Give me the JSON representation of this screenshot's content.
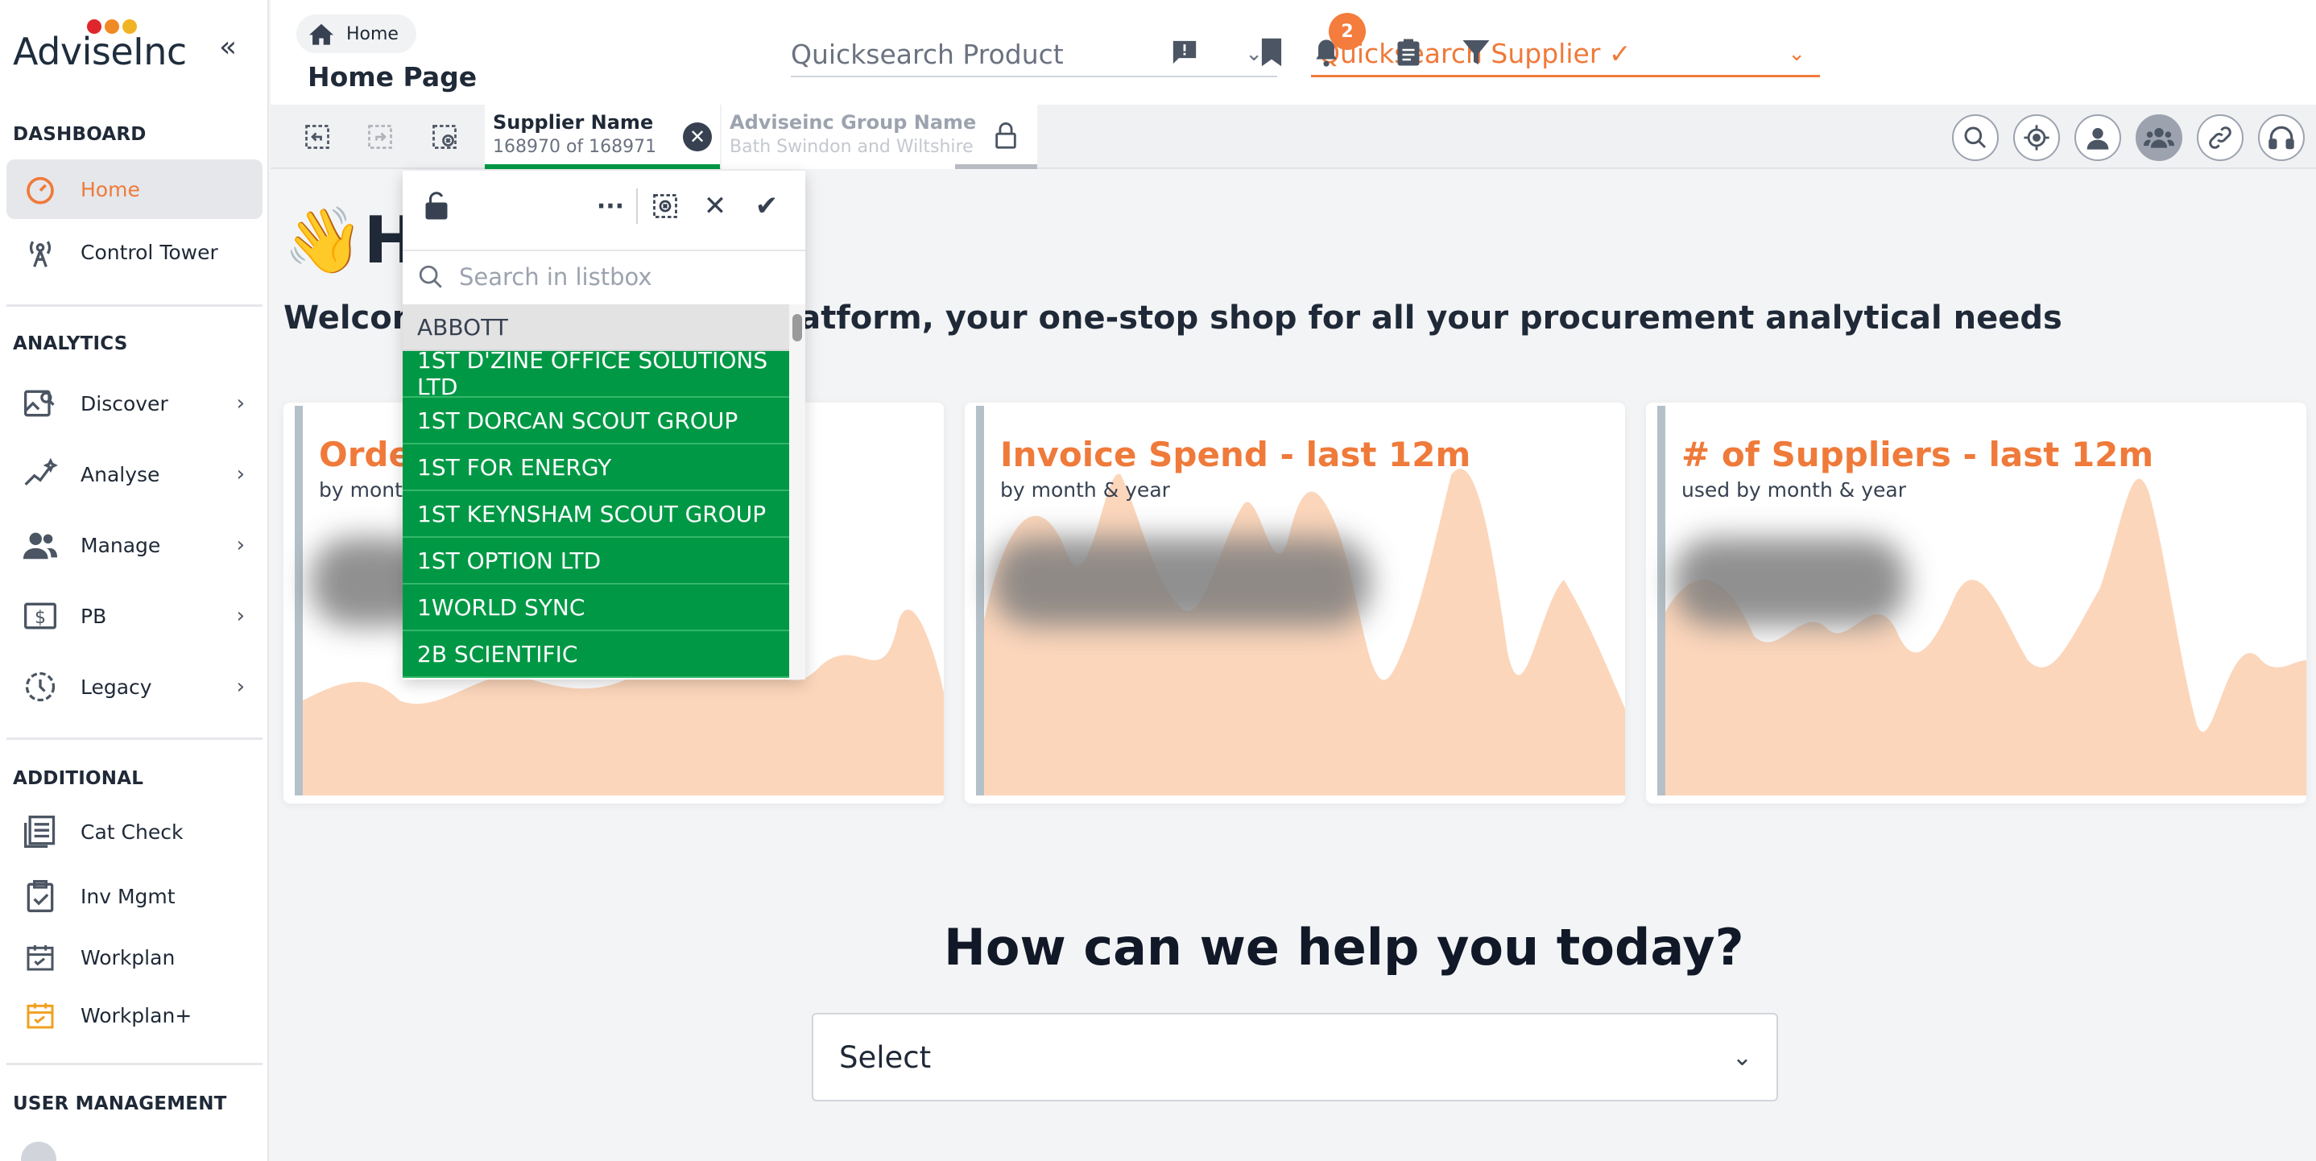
{
  "brand": {
    "name": "AdviseInc",
    "dot_colors": [
      "#e0262d",
      "#f08a24",
      "#f0b323"
    ]
  },
  "accent": "#ef7a3a",
  "sidebar": {
    "sections": {
      "dashboard": "DASHBOARD",
      "analytics": "ANALYTICS",
      "additional": "ADDITIONAL",
      "user_management": "USER MANAGEMENT"
    },
    "dashboard_items": [
      {
        "label": "Home",
        "icon": "speedometer-icon",
        "active": true
      },
      {
        "label": "Control Tower",
        "icon": "antenna-icon"
      }
    ],
    "analytics_items": [
      {
        "label": "Discover",
        "icon": "image-search-icon"
      },
      {
        "label": "Analyse",
        "icon": "trend-sparkle-icon"
      },
      {
        "label": "Manage",
        "icon": "people-icon"
      },
      {
        "label": "PB",
        "icon": "dollar-icon"
      },
      {
        "label": "Legacy",
        "icon": "history-icon"
      }
    ],
    "additional_items": [
      {
        "label": "Cat Check",
        "icon": "list-icon"
      },
      {
        "label": "Inv Mgmt",
        "icon": "clipboard-check-icon"
      },
      {
        "label": "Workplan",
        "icon": "calendar-check-icon"
      },
      {
        "label": "Workplan+",
        "icon": "calendar-plus-icon"
      }
    ]
  },
  "header": {
    "breadcrumb": "Home",
    "page_title": "Home Page",
    "quicksearch_product": "Quicksearch Product",
    "quicksearch_supplier": "Quicksearch Supplier ✓",
    "notification_count": "2"
  },
  "selections": {
    "chips": [
      {
        "title": "Supplier Name",
        "subtitle": "168970 of 168971"
      },
      {
        "title": "Adviseinc Group Name",
        "subtitle": "Bath Swindon and Wiltshire"
      }
    ]
  },
  "listbox": {
    "search_placeholder": "Search in listbox",
    "items": [
      {
        "label": "ABBOTT",
        "state": "alternative"
      },
      {
        "label": "1ST D'ZINE OFFICE SOLUTIONS LTD",
        "state": "selected"
      },
      {
        "label": "1ST DORCAN SCOUT GROUP",
        "state": "selected"
      },
      {
        "label": "1ST FOR ENERGY",
        "state": "selected"
      },
      {
        "label": "1ST KEYNSHAM SCOUT GROUP",
        "state": "selected"
      },
      {
        "label": "1ST OPTION LTD",
        "state": "selected"
      },
      {
        "label": "1WORLD SYNC",
        "state": "selected"
      },
      {
        "label": "2B SCIENTIFIC",
        "state": "selected"
      }
    ]
  },
  "main": {
    "greeting": "Hi",
    "greeting_emoji": "👋",
    "welcome": "Welcome to the AdviseInc platform, your one-stop shop for all your procurement analytical needs",
    "cards": [
      {
        "title": "Orders - last 12m",
        "subtitle": "by month & year"
      },
      {
        "title": "Invoice Spend - last 12m",
        "subtitle": "by month & year"
      },
      {
        "title": "# of Suppliers - last 12m",
        "subtitle": "used by month & year"
      }
    ],
    "help_heading": "How can we help you today?",
    "help_select": "Select"
  }
}
